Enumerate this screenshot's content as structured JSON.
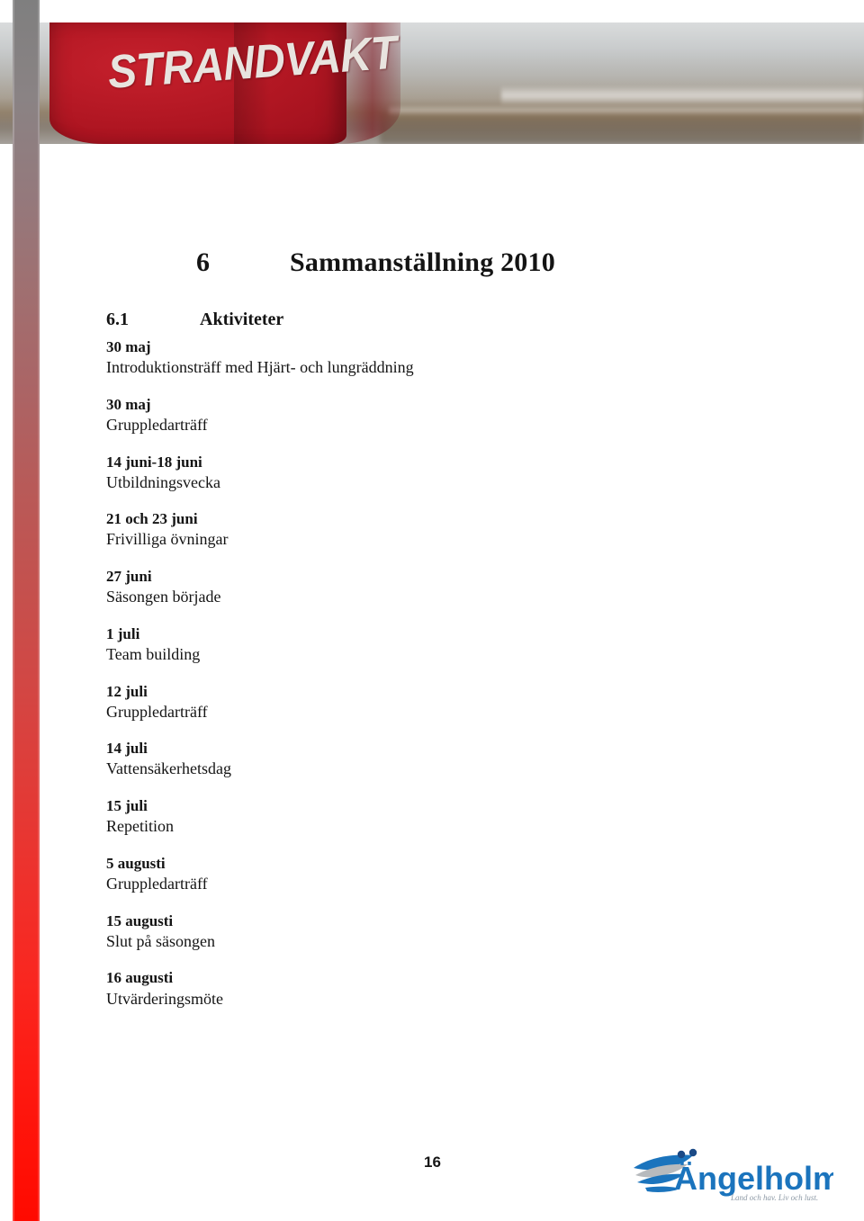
{
  "banner": {
    "shirt_text": "STRANDVAKT",
    "alt": "lifeguard in red STRANDVAKT shirt on a beach"
  },
  "chapter": {
    "number": "6",
    "title": "Sammanställning 2010"
  },
  "section": {
    "number": "6.1",
    "title": "Aktiviteter"
  },
  "activities": [
    {
      "date": "30 maj",
      "description": "Introduktionsträff med Hjärt- och lungräddning"
    },
    {
      "date": "30 maj",
      "description": "Gruppledarträff"
    },
    {
      "date": "14 juni-18 juni",
      "description": "Utbildningsvecka"
    },
    {
      "date": "21 och 23 juni",
      "description": "Frivilliga övningar"
    },
    {
      "date": "27 juni",
      "description": "Säsongen började"
    },
    {
      "date": "1 juli",
      "description": "Team building"
    },
    {
      "date": "12 juli",
      "description": "Gruppledarträff"
    },
    {
      "date": "14 juli",
      "description": "Vattensäkerhetsdag"
    },
    {
      "date": "15 juli",
      "description": "Repetition"
    },
    {
      "date": "5 augusti",
      "description": "Gruppledarträff"
    },
    {
      "date": "15 augusti",
      "description": "Slut på säsongen"
    },
    {
      "date": "16 augusti",
      "description": "Utvärderingsmöte"
    }
  ],
  "footer": {
    "page_number": "16",
    "logo_name": "Ängelholm",
    "logo_tagline": "Land och hav. Liv och lust."
  },
  "colors": {
    "stripe_top": "#7f7f7f",
    "stripe_bottom": "#ff0a00",
    "shirt_red": "#b01622",
    "logo_blue": "#1b74bd",
    "logo_gray": "#9a9a9a",
    "text": "#141414"
  }
}
